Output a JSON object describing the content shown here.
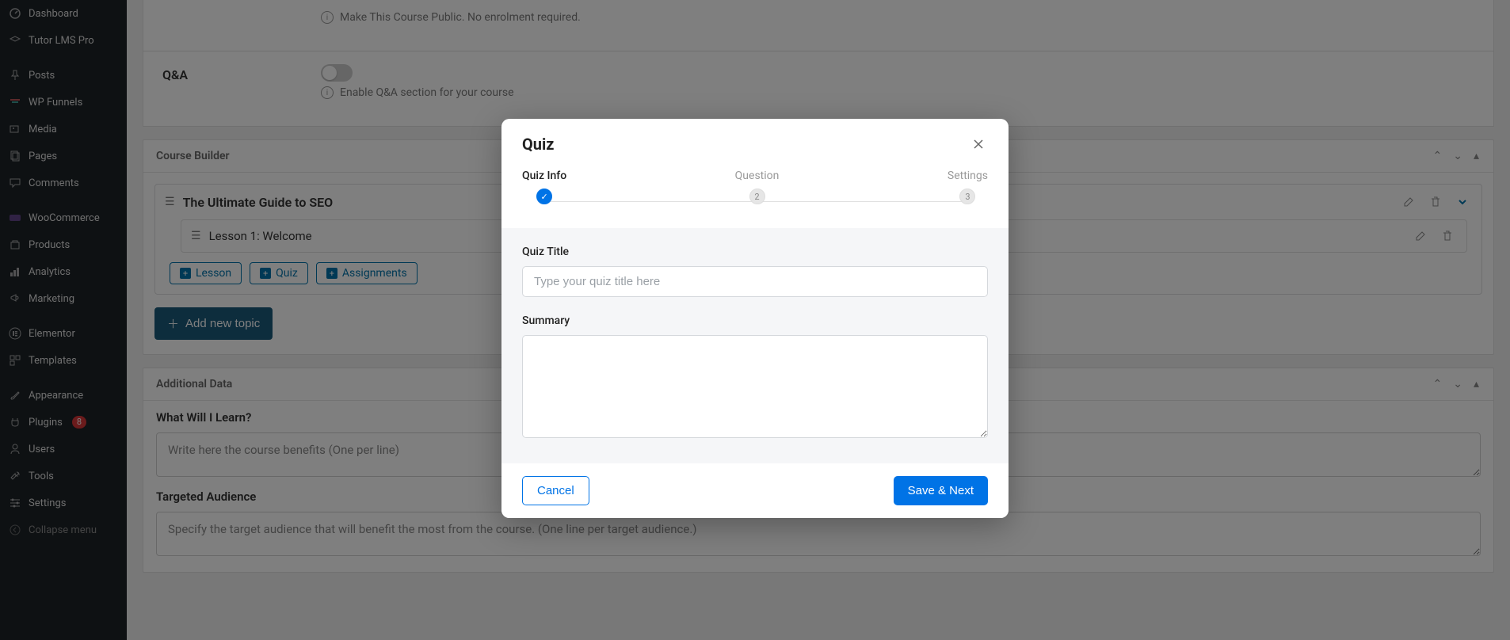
{
  "sidebar": {
    "items": [
      {
        "label": "Dashboard"
      },
      {
        "label": "Tutor LMS Pro"
      },
      {
        "label": "Posts"
      },
      {
        "label": "WP Funnels"
      },
      {
        "label": "Media"
      },
      {
        "label": "Pages"
      },
      {
        "label": "Comments"
      },
      {
        "label": "WooCommerce"
      },
      {
        "label": "Products"
      },
      {
        "label": "Analytics"
      },
      {
        "label": "Marketing"
      },
      {
        "label": "Elementor"
      },
      {
        "label": "Templates"
      },
      {
        "label": "Appearance"
      },
      {
        "label": "Plugins",
        "badge": "8"
      },
      {
        "label": "Users"
      },
      {
        "label": "Tools"
      },
      {
        "label": "Settings"
      }
    ],
    "collapse": "Collapse menu"
  },
  "course": {
    "publicInfo": "Make This Course Public. No enrolment required.",
    "qaLabel": "Q&A",
    "qaInfo": "Enable Q&A section for your course"
  },
  "builder": {
    "title": "Course Builder",
    "topic": "The Ultimate Guide to SEO",
    "lesson": "Lesson 1: Welcome",
    "chips": {
      "lesson": "Lesson",
      "quiz": "Quiz",
      "assignments": "Assignments"
    },
    "addTopic": "Add new topic"
  },
  "additional": {
    "title": "Additional Data",
    "learnLabel": "What Will I Learn?",
    "learnPlaceholder": "Write here the course benefits (One per line)",
    "audienceLabel": "Targeted Audience",
    "audiencePlaceholder": "Specify the target audience that will benefit the most from the course. (One line per target audience.)"
  },
  "modal": {
    "title": "Quiz",
    "steps": {
      "info": "Quiz Info",
      "question": "Question",
      "settings": "Settings",
      "n2": "2",
      "n3": "3"
    },
    "quizTitleLabel": "Quiz Title",
    "quizTitlePlaceholder": "Type your quiz title here",
    "summaryLabel": "Summary",
    "cancel": "Cancel",
    "save": "Save & Next"
  }
}
